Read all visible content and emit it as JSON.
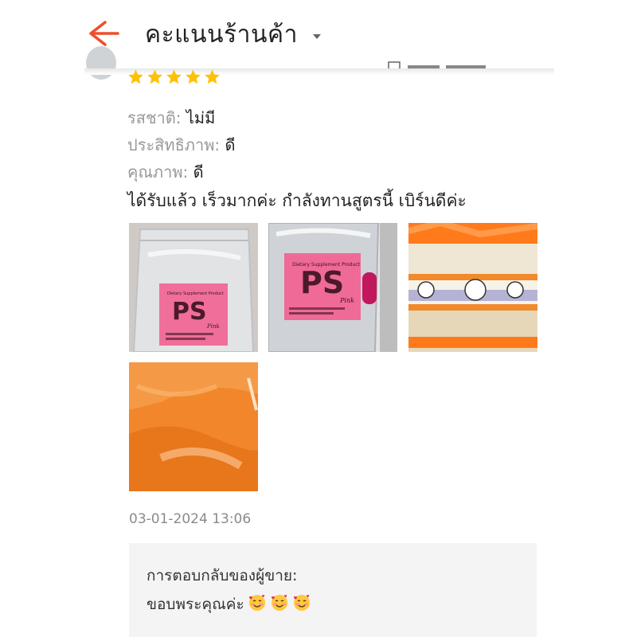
{
  "header": {
    "title": "คะแนนร้านค้า",
    "back_icon": "arrow-left-icon",
    "dropdown_icon": "caret-down-icon",
    "accent_color": "#ee4d2d"
  },
  "review": {
    "rating": 5,
    "rating_max": 5,
    "star_color": "#ffc107",
    "attributes": [
      {
        "label": "รสชาติ:",
        "value": "ไม่มี"
      },
      {
        "label": "ประสิทธิภาพ:",
        "value": "ดี"
      },
      {
        "label": "คุณภาพ:",
        "value": "ดี"
      }
    ],
    "comment": "ได้รับแล้ว เร็วมากค่ะ กำลังทานสูตรนี้ เบิร์นดีค่ะ",
    "photos": [
      {
        "brand": "PS",
        "caption": "Dietary Supplement Product",
        "variant": "Pink"
      },
      {
        "brand": "PS",
        "caption": "Dietary Supplement Product",
        "variant": "Pink"
      },
      {
        "description": "orange-tape-box"
      },
      {
        "description": "orange-mailer-bag"
      }
    ],
    "timestamp": "03-01-2024 13:06"
  },
  "seller_reply": {
    "label": "การตอบกลับของผู้ขาย:",
    "text": "ขอบพระคุณค่ะ",
    "emoji_count": 3,
    "emoji_icon": "smiling-face-with-hearts-icon"
  }
}
